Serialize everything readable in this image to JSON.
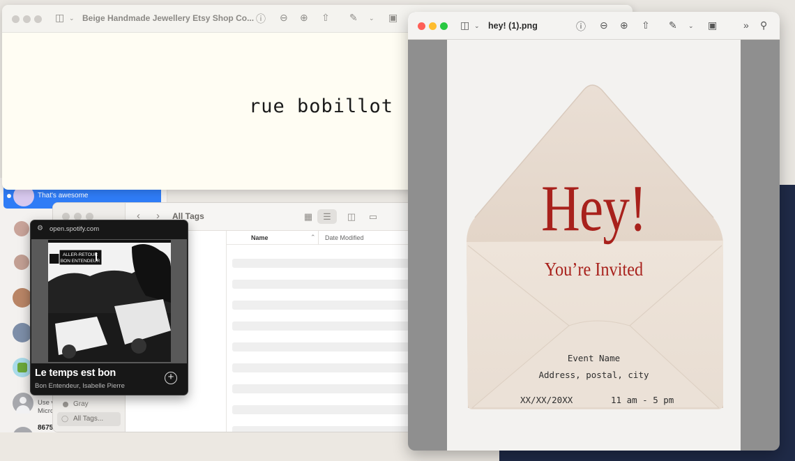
{
  "messages": {
    "rows": [
      {
        "snippet": "That's awesome",
        "selected": true
      },
      {
        "snippet": "",
        "selected": false
      },
      {
        "snippet": "",
        "selected": false
      },
      {
        "snippet": "",
        "selected": false
      },
      {
        "snippet": "",
        "selected": false
      },
      {
        "snippet": "",
        "selected": false
      },
      {
        "name": "(…",
        "snippet": "Use v",
        "snippet2": "Micro",
        "selected": false
      },
      {
        "name": "8675",
        "snippet": "",
        "selected": false
      }
    ]
  },
  "finder": {
    "title": "All Tags",
    "columns": {
      "name": "Name",
      "date": "Date Modified"
    },
    "sidebar": {
      "gray": "Gray",
      "all_tags": "All Tags..."
    }
  },
  "preview_back": {
    "title": "Beige Handmade Jewellery Etsy Shop Co...",
    "content": "rue bobillot"
  },
  "spotify": {
    "url": "open.spotify.com",
    "track": "Le temps est bon",
    "artists": "Bon Entendeur, Isabelle Pierre",
    "art_sign_line1": "ALLER-RETOUR",
    "art_sign_line2": "BON ENTENDEUR"
  },
  "preview_front": {
    "title": "hey! (1).png",
    "card": {
      "headline": "Hey!",
      "subhead": "You’re Invited",
      "event_name": "Event Name",
      "address": "Address, postal, city",
      "date": "XX/XX/20XX",
      "time": "11 am - 5 pm"
    }
  },
  "colors": {
    "accent_red": "#a8211c",
    "selection_blue": "#2f7cf6",
    "navy": "#1f2a47"
  }
}
